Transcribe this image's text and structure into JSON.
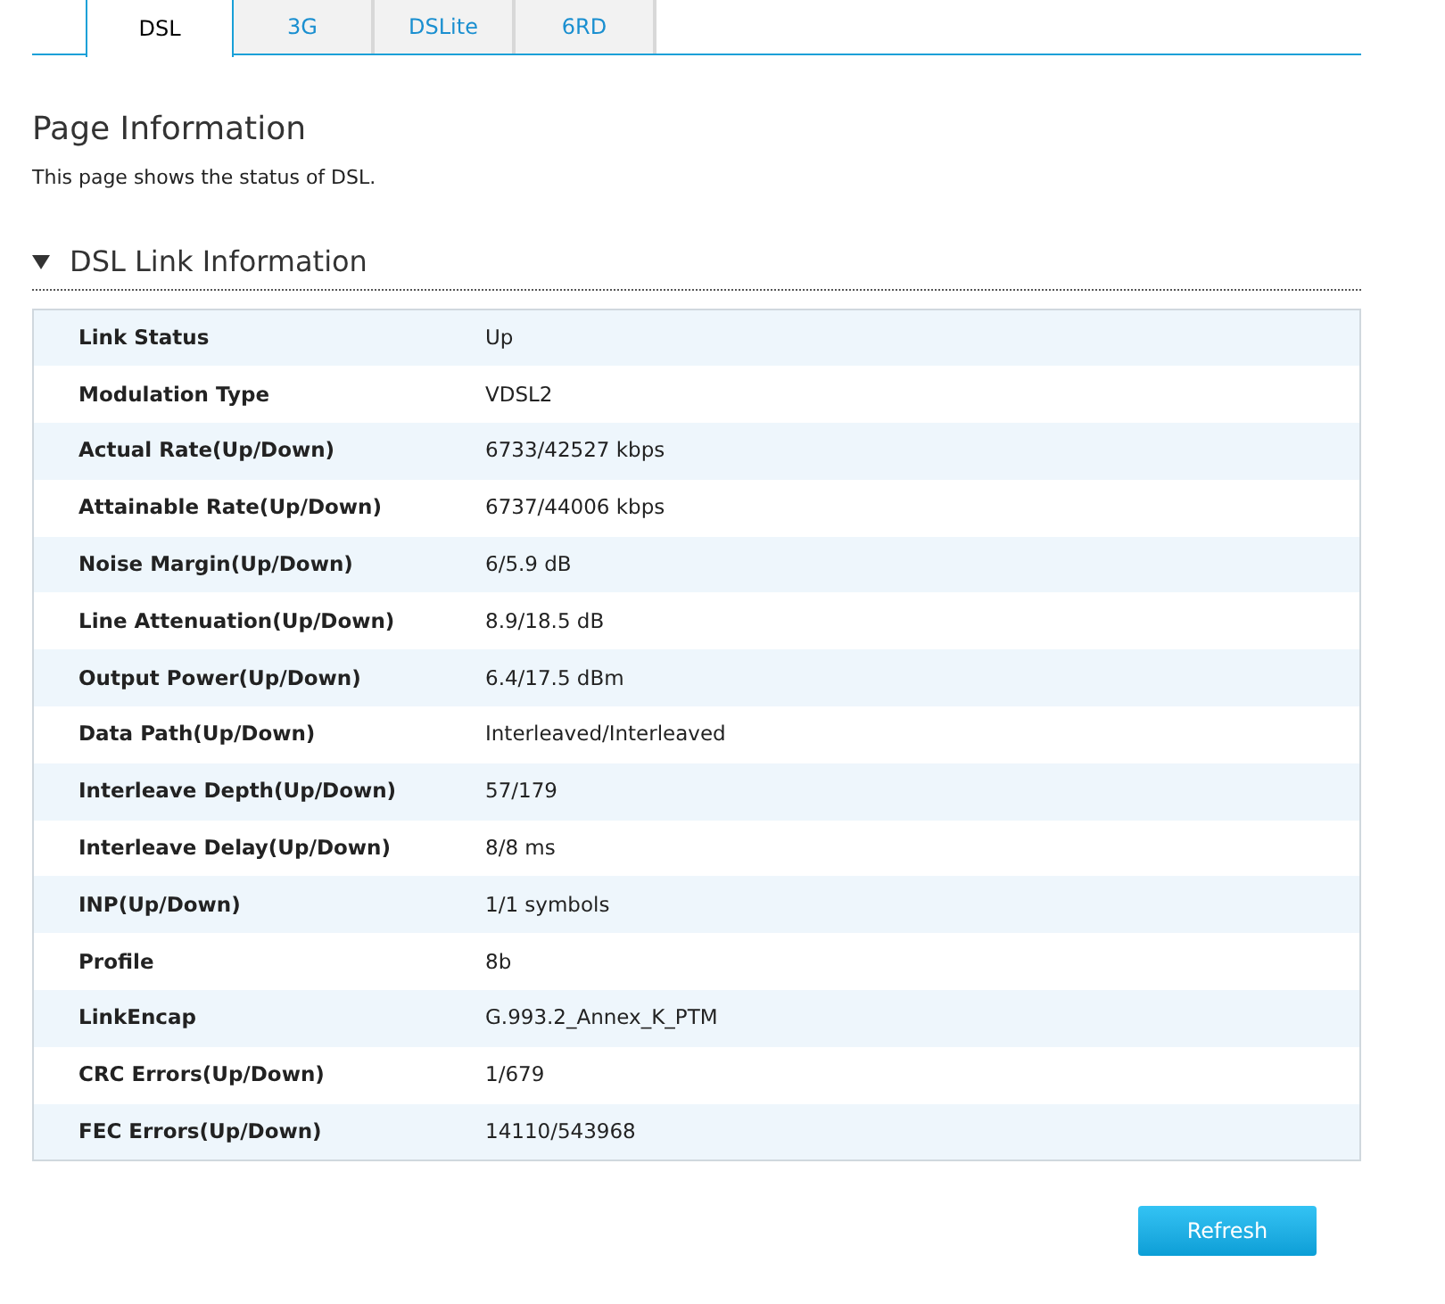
{
  "tabs": [
    {
      "label": "DSL",
      "selected": true
    },
    {
      "label": "3G",
      "selected": false
    },
    {
      "label": "DSLite",
      "selected": false
    },
    {
      "label": "6RD",
      "selected": false
    }
  ],
  "page": {
    "title": "Page Information",
    "description": "This page shows the status of DSL."
  },
  "section": {
    "title": "DSL Link Information",
    "expanded": true
  },
  "rows": [
    {
      "label": "Link Status",
      "value": "Up"
    },
    {
      "label": "Modulation Type",
      "value": "VDSL2"
    },
    {
      "label": "Actual Rate(Up/Down)",
      "value": "6733/42527 kbps"
    },
    {
      "label": "Attainable Rate(Up/Down)",
      "value": "6737/44006 kbps"
    },
    {
      "label": "Noise Margin(Up/Down)",
      "value": "6/5.9 dB"
    },
    {
      "label": "Line Attenuation(Up/Down)",
      "value": "8.9/18.5 dB"
    },
    {
      "label": "Output Power(Up/Down)",
      "value": "6.4/17.5 dBm"
    },
    {
      "label": "Data Path(Up/Down)",
      "value": "Interleaved/Interleaved"
    },
    {
      "label": "Interleave Depth(Up/Down)",
      "value": "57/179"
    },
    {
      "label": "Interleave Delay(Up/Down)",
      "value": "8/8 ms"
    },
    {
      "label": "INP(Up/Down)",
      "value": "1/1 symbols"
    },
    {
      "label": "Profile",
      "value": "8b"
    },
    {
      "label": "LinkEncap",
      "value": "G.993.2_Annex_K_PTM"
    },
    {
      "label": "CRC Errors(Up/Down)",
      "value": "1/679"
    },
    {
      "label": "FEC Errors(Up/Down)",
      "value": "14110/543968"
    }
  ],
  "refresh_button": "Refresh"
}
